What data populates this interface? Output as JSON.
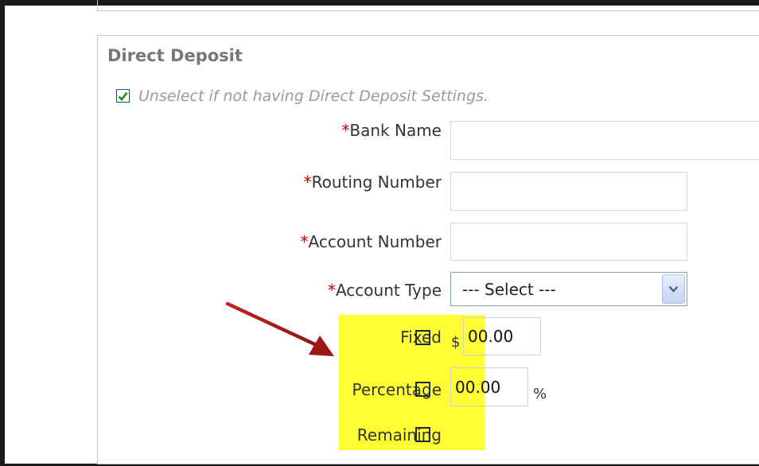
{
  "section": {
    "title": "Direct Deposit",
    "note": "Unselect if not having Direct Deposit Settings.",
    "note_checked": true
  },
  "fields": {
    "bank_name": {
      "required": "*",
      "label": "Bank Name",
      "value": ""
    },
    "routing_number": {
      "required": "*",
      "label": "Routing Number",
      "value": ""
    },
    "account_number": {
      "required": "*",
      "label": "Account Number",
      "value": ""
    },
    "account_type": {
      "required": "*",
      "label": "Account Type",
      "selected": "--- Select ---"
    }
  },
  "allocation": {
    "fixed": {
      "label": "Fixed",
      "checked": false,
      "unit": "$",
      "value": "00.00"
    },
    "percentage": {
      "label": "Percentage",
      "checked": false,
      "unit": "%",
      "value": "00.00"
    },
    "remaining": {
      "label": "Remaining",
      "checked": false
    }
  },
  "colors": {
    "highlight": "#ffff33",
    "arrow": "#b01c1c",
    "required": "#cc0000"
  },
  "icons": [
    "checkmark-icon",
    "chevron-down-icon",
    "red-arrow-icon"
  ]
}
